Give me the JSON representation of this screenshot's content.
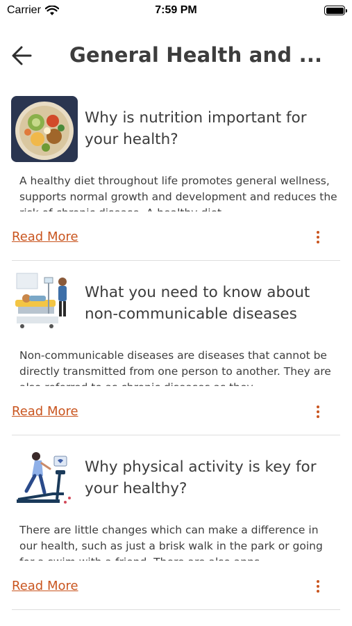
{
  "status_bar": {
    "carrier": "Carrier",
    "time": "7:59 PM"
  },
  "header": {
    "title": "General  Health and ...",
    "back_icon": "arrow-left-icon"
  },
  "articles": [
    {
      "title": "Why is nutrition important for your health?",
      "body": "A healthy diet throughout life promotes general wellness, supports normal growth and development and reduces the risk of chronic disease. A healthy diet",
      "read_more": "Read More",
      "image": "healthy-food-bowl"
    },
    {
      "title": "What you need to know about non-communicable diseases",
      "body": "Non-communicable diseases are diseases that cannot be directly transmitted from one person to another. They are also referred to as chronic diseases as they",
      "read_more": "Read More",
      "image": "hospital-bed-illustration"
    },
    {
      "title": "Why physical activity is key for your healthy?",
      "body": "There are little changes which can make a difference in our health, such as just a brisk walk in the park or going for a swim with a friend. There are also apps",
      "read_more": "Read More",
      "image": "treadmill-illustration"
    }
  ],
  "colors": {
    "accent": "#c9551f",
    "text": "#3b3b3b",
    "divider": "#dedede"
  }
}
